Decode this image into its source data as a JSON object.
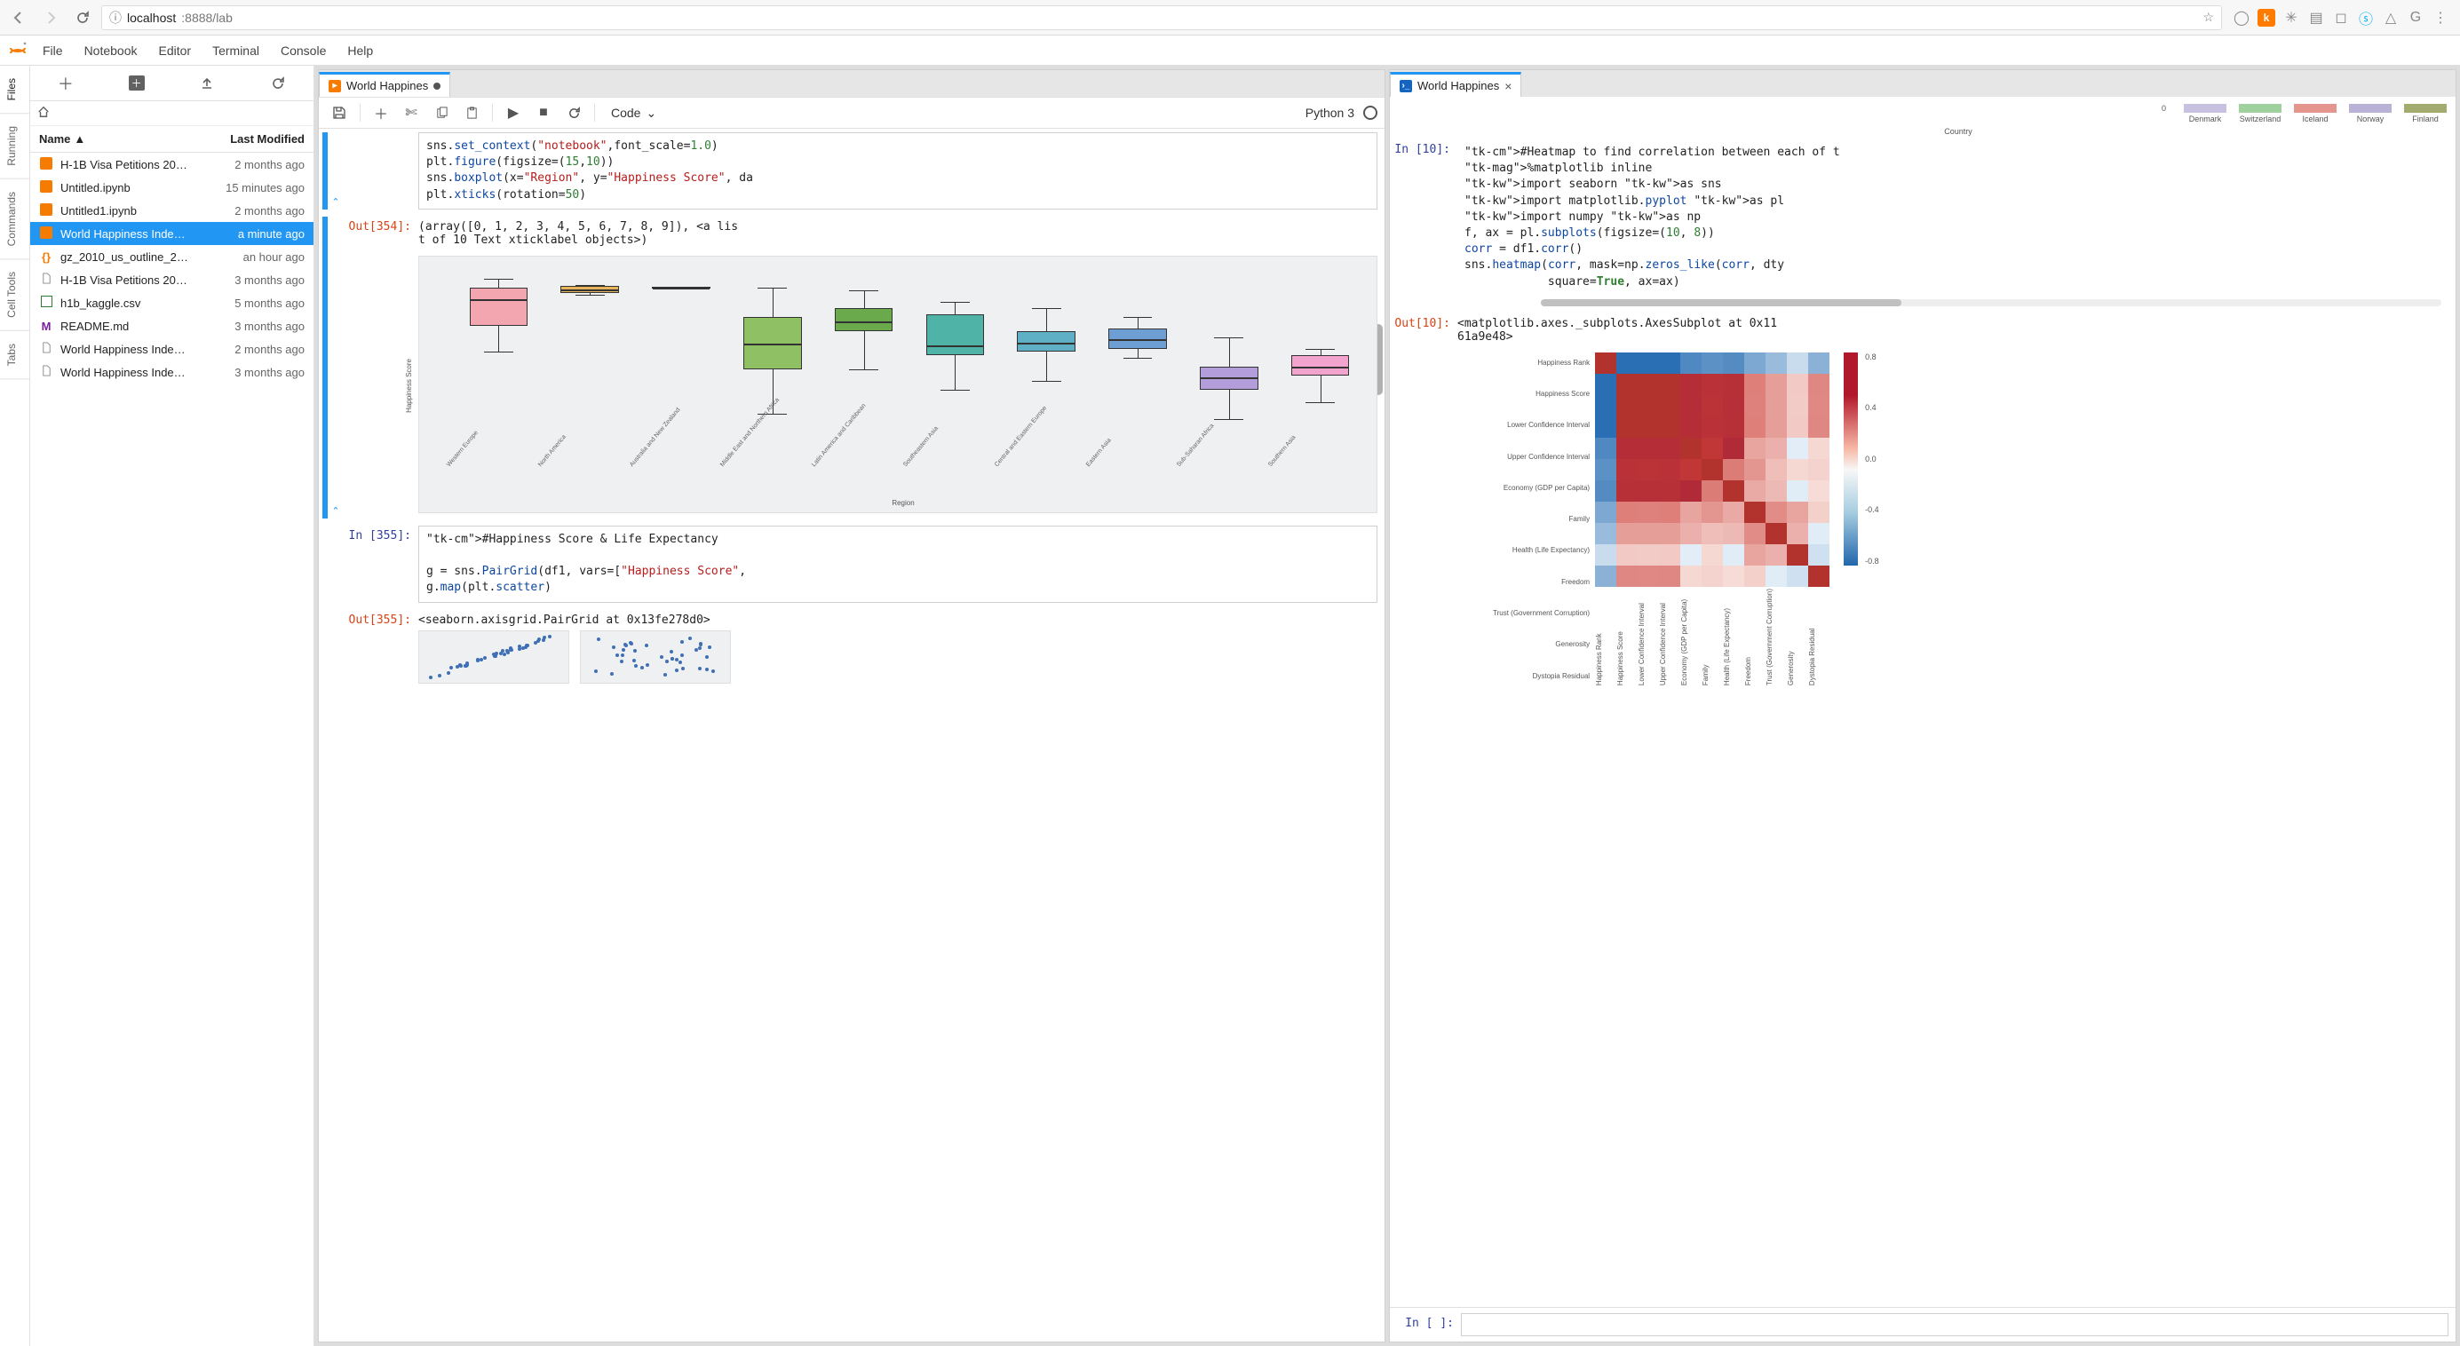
{
  "browser": {
    "url_info_icon": "ⓘ",
    "url_host": "localhost",
    "url_rest": ":8888/lab"
  },
  "menu": [
    "File",
    "Notebook",
    "Editor",
    "Terminal",
    "Console",
    "Help"
  ],
  "activity_tabs": [
    "Files",
    "Running",
    "Commands",
    "Cell Tools",
    "Tabs"
  ],
  "file_browser": {
    "header_name": "Name",
    "header_modified": "Last Modified",
    "rows": [
      {
        "icon": "nb",
        "name": "H-1B Visa Petitions 20…",
        "modified": "2 months ago",
        "selected": false
      },
      {
        "icon": "nb",
        "name": "Untitled.ipynb",
        "modified": "15 minutes ago",
        "selected": false
      },
      {
        "icon": "nb",
        "name": "Untitled1.ipynb",
        "modified": "2 months ago",
        "selected": false
      },
      {
        "icon": "nb",
        "name": "World Happiness Inde…",
        "modified": "a minute ago",
        "selected": true
      },
      {
        "icon": "json",
        "name": "gz_2010_us_outline_2…",
        "modified": "an hour ago",
        "selected": false
      },
      {
        "icon": "file",
        "name": "H-1B Visa Petitions 20…",
        "modified": "3 months ago",
        "selected": false
      },
      {
        "icon": "csv",
        "name": "h1b_kaggle.csv",
        "modified": "5 months ago",
        "selected": false
      },
      {
        "icon": "md",
        "name": "README.md",
        "modified": "3 months ago",
        "selected": false
      },
      {
        "icon": "file",
        "name": "World Happiness Inde…",
        "modified": "2 months ago",
        "selected": false
      },
      {
        "icon": "file",
        "name": "World Happiness Inde…",
        "modified": "3 months ago",
        "selected": false
      }
    ]
  },
  "notebook_panel": {
    "tab_label": "World Happines",
    "toolbar_celltype": "Code",
    "kernel_name": "Python 3",
    "cells": {
      "code354": "sns.set_context(\"notebook\",font_scale=1.0)\nplt.figure(figsize=(15,10))\nsns.boxplot(x=\"Region\", y=\"Happiness Score\", da\nplt.xticks(rotation=50)",
      "prompt_out354": "Out[354]:",
      "out354": "(array([0, 1, 2, 3, 4, 5, 6, 7, 8, 9]), <a lis\nt of 10 Text xticklabel objects>)",
      "prompt_in355": "In [355]:",
      "code355": "#Happiness Score & Life Expectancy\n\ng = sns.PairGrid(df1, vars=[\"Happiness Score\",\ng.map(plt.scatter)",
      "prompt_out355": "Out[355]:",
      "out355": "<seaborn.axisgrid.PairGrid at 0x13fe278d0>"
    }
  },
  "console_panel": {
    "tab_label": "World Happines",
    "prompt_in10": "In [10]:",
    "code10_line1": "#Heatmap to find correlation between each of t",
    "code10_line2": "%matplotlib inline",
    "code10_line3": "import seaborn as sns",
    "code10_line4": "import matplotlib.pyplot as pl",
    "code10_line5": "import numpy as np",
    "code10_line6": "f, ax = pl.subplots(figsize=(10, 8))",
    "code10_line7": "corr = df1.corr()",
    "code10_line8": "sns.heatmap(corr, mask=np.zeros_like(corr, dty",
    "code10_line9": "            square=True, ax=ax)",
    "prompt_out10": "Out[10]:",
    "out10": "<matplotlib.axes._subplots.AxesSubplot at 0x11\n61a9e48>",
    "prompt_empty": "In [ ]:",
    "legend": {
      "axis_val": "0",
      "items": [
        "Denmark",
        "Switzerland",
        "Iceland",
        "Norway",
        "Finland"
      ],
      "axis_title": "Country",
      "colors": [
        "#c8c1e0",
        "#9fd19f",
        "#e4968e",
        "#b9b2d6",
        "#a3ab6e"
      ]
    }
  },
  "chart_data": [
    {
      "type": "boxplot",
      "title": "",
      "xlabel": "Region",
      "ylabel": "Happiness Score",
      "ylim": [
        2,
        8
      ],
      "categories": [
        "Western Europe",
        "North America",
        "Australia and New Zealand",
        "Middle East and Northern Africa",
        "Latin America and Caribbean",
        "Southeastern Asia",
        "Central and Eastern Europe",
        "Eastern Asia",
        "Sub-Saharan Africa",
        "Southern Asia"
      ],
      "boxes": [
        {
          "region": "Western Europe",
          "q1": 6.0,
          "median": 6.9,
          "q3": 7.3,
          "low": 5.1,
          "high": 7.6,
          "color": "#f4a6b0"
        },
        {
          "region": "North America",
          "q1": 7.1,
          "median": 7.25,
          "q3": 7.35,
          "low": 7.05,
          "high": 7.4,
          "color": "#e7b35b"
        },
        {
          "region": "Australia and New Zealand",
          "q1": 7.28,
          "median": 7.31,
          "q3": 7.33,
          "low": 7.27,
          "high": 7.34,
          "color": "#e5e5e5"
        },
        {
          "region": "Middle East and Northern Africa",
          "q1": 4.5,
          "median": 5.4,
          "q3": 6.3,
          "low": 3.0,
          "high": 7.3,
          "color": "#8fc164"
        },
        {
          "region": "Latin America and Caribbean",
          "q1": 5.8,
          "median": 6.15,
          "q3": 6.6,
          "low": 4.5,
          "high": 7.2,
          "color": "#6aaa4c"
        },
        {
          "region": "Southeastern Asia",
          "q1": 5.0,
          "median": 5.3,
          "q3": 6.4,
          "low": 3.8,
          "high": 6.8,
          "color": "#4fb3a7"
        },
        {
          "region": "Central and Eastern Europe",
          "q1": 5.1,
          "median": 5.4,
          "q3": 5.8,
          "low": 4.1,
          "high": 6.6,
          "color": "#5fb0c4"
        },
        {
          "region": "Eastern Asia",
          "q1": 5.2,
          "median": 5.55,
          "q3": 5.9,
          "low": 4.9,
          "high": 6.3,
          "color": "#6e9fd4"
        },
        {
          "region": "Sub-Saharan Africa",
          "q1": 3.8,
          "median": 4.25,
          "q3": 4.6,
          "low": 2.8,
          "high": 5.6,
          "color": "#b39ddb"
        },
        {
          "region": "Southern Asia",
          "q1": 4.3,
          "median": 4.6,
          "q3": 5.0,
          "low": 3.4,
          "high": 5.2,
          "color": "#f2a3ce"
        }
      ]
    },
    {
      "type": "heatmap",
      "title": "",
      "labels": [
        "Happiness Rank",
        "Happiness Score",
        "Lower Confidence Interval",
        "Upper Confidence Interval",
        "Economy (GDP per Capita)",
        "Family",
        "Health (Life Expectancy)",
        "Freedom",
        "Trust (Government Corruption)",
        "Generosity",
        "Dystopia Residual"
      ],
      "colorbar_ticks": [
        "0.8",
        "0.4",
        "0.0",
        "-0.4",
        "-0.8"
      ],
      "matrix": [
        [
          1.0,
          -0.99,
          -0.99,
          -0.99,
          -0.79,
          -0.73,
          -0.77,
          -0.55,
          -0.4,
          -0.15,
          -0.48
        ],
        [
          -0.99,
          1.0,
          0.99,
          0.99,
          0.79,
          0.74,
          0.77,
          0.57,
          0.4,
          0.16,
          0.53
        ],
        [
          -0.99,
          0.99,
          1.0,
          0.99,
          0.79,
          0.73,
          0.77,
          0.56,
          0.4,
          0.15,
          0.52
        ],
        [
          -0.99,
          0.99,
          0.99,
          1.0,
          0.79,
          0.74,
          0.76,
          0.57,
          0.4,
          0.16,
          0.53
        ],
        [
          -0.79,
          0.79,
          0.79,
          0.79,
          1.0,
          0.67,
          0.84,
          0.36,
          0.3,
          -0.02,
          0.08
        ],
        [
          -0.73,
          0.74,
          0.73,
          0.74,
          0.67,
          1.0,
          0.59,
          0.45,
          0.22,
          0.08,
          0.11
        ],
        [
          -0.77,
          0.77,
          0.77,
          0.76,
          0.84,
          0.59,
          1.0,
          0.34,
          0.25,
          -0.03,
          0.06
        ],
        [
          -0.55,
          0.57,
          0.56,
          0.57,
          0.36,
          0.45,
          0.34,
          1.0,
          0.5,
          0.36,
          0.12
        ],
        [
          -0.4,
          0.4,
          0.4,
          0.4,
          0.3,
          0.22,
          0.25,
          0.5,
          1.0,
          0.3,
          -0.03
        ],
        [
          -0.15,
          0.16,
          0.15,
          0.16,
          -0.02,
          0.08,
          -0.03,
          0.36,
          0.3,
          1.0,
          -0.12
        ],
        [
          -0.48,
          0.53,
          0.52,
          0.53,
          0.08,
          0.11,
          0.06,
          0.12,
          -0.03,
          -0.12,
          1.0
        ]
      ]
    }
  ]
}
